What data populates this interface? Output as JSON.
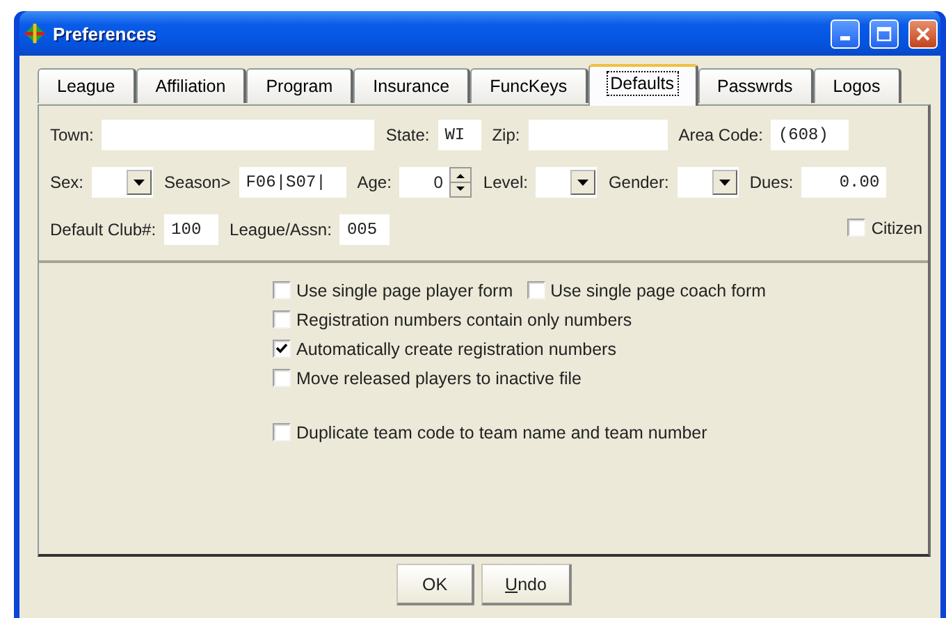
{
  "window": {
    "title": "Preferences"
  },
  "tabs": [
    {
      "label": "League",
      "selected": false
    },
    {
      "label": "Affiliation",
      "selected": false
    },
    {
      "label": "Program",
      "selected": false
    },
    {
      "label": "Insurance",
      "selected": false
    },
    {
      "label": "FuncKeys",
      "selected": false
    },
    {
      "label": "Defaults",
      "selected": true
    },
    {
      "label": "Passwrds",
      "selected": false
    },
    {
      "label": "Logos",
      "selected": false
    }
  ],
  "fields": [
    [
      {
        "kind": "label",
        "text": "Town:"
      },
      {
        "kind": "text"
      },
      {
        "kind": "label",
        "text": "State:"
      },
      {
        "kind": "text",
        "value": "WI"
      },
      {
        "kind": "label",
        "text": "Zip:"
      },
      {
        "kind": "text"
      },
      {
        "kind": "label",
        "text": "Area Code:"
      },
      {
        "kind": "text",
        "value": "(608)"
      }
    ],
    [
      {
        "kind": "label",
        "text": "Sex:"
      },
      {
        "kind": "combo"
      },
      {
        "kind": "label",
        "text": "Season>"
      },
      {
        "kind": "text",
        "value": "F06|S07|"
      },
      {
        "kind": "label",
        "text": "Age:"
      },
      {
        "kind": "spin",
        "value": "0"
      },
      {
        "kind": "label",
        "text": "Level:"
      },
      {
        "kind": "combo"
      },
      {
        "kind": "label",
        "text": "Gender:"
      },
      {
        "kind": "combo"
      },
      {
        "kind": "label",
        "text": "Dues:"
      },
      {
        "kind": "text",
        "value": "0.00"
      }
    ],
    [
      {
        "kind": "label",
        "text": "Default Club#:"
      },
      {
        "kind": "text",
        "value": "100"
      },
      {
        "kind": "label",
        "text": "League/Assn:"
      },
      {
        "kind": "text",
        "value": "005"
      },
      {
        "kind": "check",
        "label": "Citizen",
        "checked": false
      }
    ]
  ],
  "option_groups": [
    [
      [
        {
          "label": "Use single page player form",
          "checked": false
        },
        {
          "label": "Use single page coach form",
          "checked": false
        }
      ],
      [
        {
          "label": "Registration numbers contain only numbers",
          "checked": false
        }
      ],
      [
        {
          "label": "Automatically create registration numbers",
          "checked": true
        }
      ],
      [
        {
          "label": "Move released players to inactive file",
          "checked": false
        }
      ]
    ],
    [
      [
        {
          "label": "Duplicate team code to team name and team number",
          "checked": false
        }
      ]
    ]
  ],
  "buttons": [
    {
      "label": "OK",
      "underline_first": false
    },
    {
      "label": "Undo",
      "underline_first": true
    }
  ]
}
